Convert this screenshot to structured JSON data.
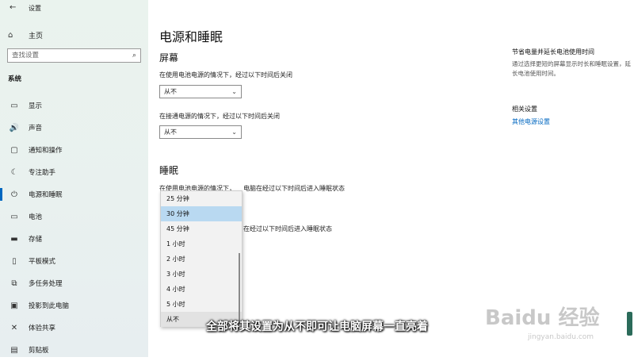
{
  "window": {
    "title": "设置",
    "back": "←"
  },
  "sidebar": {
    "home_label": "主页",
    "search_placeholder": "查找设置",
    "section": "系统",
    "items": [
      {
        "label": "显示",
        "icon": "monitor-icon",
        "glyph": "▭"
      },
      {
        "label": "声音",
        "icon": "speaker-icon",
        "glyph": "🔊"
      },
      {
        "label": "通知和操作",
        "icon": "notification-icon",
        "glyph": "▢"
      },
      {
        "label": "专注助手",
        "icon": "moon-icon",
        "glyph": "☾"
      },
      {
        "label": "电源和睡眠",
        "icon": "power-icon",
        "glyph": "⏻"
      },
      {
        "label": "电池",
        "icon": "battery-icon",
        "glyph": "▭"
      },
      {
        "label": "存储",
        "icon": "storage-icon",
        "glyph": "▬"
      },
      {
        "label": "平板模式",
        "icon": "tablet-icon",
        "glyph": "▯"
      },
      {
        "label": "多任务处理",
        "icon": "multitask-icon",
        "glyph": "⧉"
      },
      {
        "label": "投影到此电脑",
        "icon": "project-icon",
        "glyph": "▣"
      },
      {
        "label": "体验共享",
        "icon": "share-icon",
        "glyph": "✕"
      },
      {
        "label": "剪贴板",
        "icon": "clipboard-icon",
        "glyph": "▤"
      }
    ],
    "active_index": 4
  },
  "main": {
    "title": "电源和睡眠",
    "screen": {
      "heading": "屏幕",
      "battery_label": "在使用电池电源的情况下，经过以下时间后关闭",
      "battery_value": "从不",
      "plugged_label": "在接通电源的情况下，经过以下时间后关闭",
      "plugged_value": "从不"
    },
    "sleep": {
      "heading": "睡眠",
      "battery_label_a": "在使用电池电源的情况下，",
      "battery_label_b": "电脑在经过以下时间后进入睡眠状态",
      "plugged_label_b": "在经过以下时间后进入睡眠状态"
    },
    "dropdown": {
      "options": [
        "25 分钟",
        "30 分钟",
        "45 分钟",
        "1 小时",
        "2 小时",
        "3 小时",
        "4 小时",
        "5 小时",
        "从不"
      ],
      "hover_index": 1,
      "current_index": 8
    }
  },
  "right_panel": {
    "tip_title": "节省电量并延长电池使用时间",
    "tip_text": "通过选择更短的屏幕显示时长和睡眠设置，延长电池使用时间。",
    "related_title": "相关设置",
    "related_link": "其他电源设置"
  },
  "overlay": {
    "caption": "全部将其设置为从不即可让电脑屏幕一直亮着",
    "watermark_logo": "Baidu 经验",
    "watermark_url": "jingyan.baidu.com"
  },
  "colors": {
    "accent": "#0067c0",
    "hover": "#b9d9f1"
  }
}
